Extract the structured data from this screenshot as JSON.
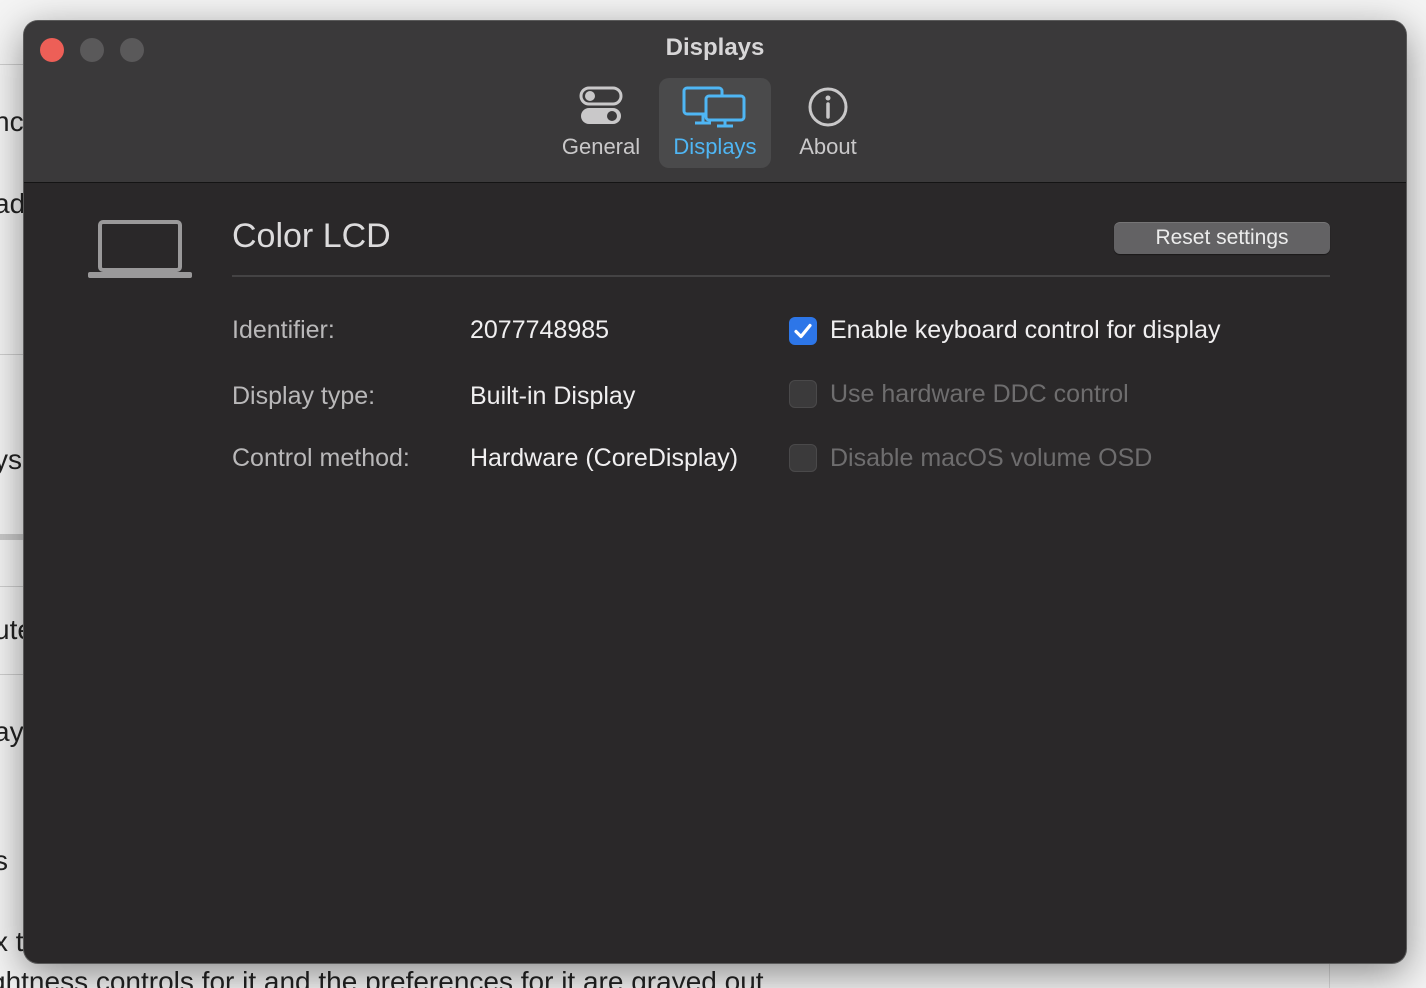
{
  "window": {
    "title": "Displays"
  },
  "tabs": [
    {
      "label": "General",
      "icon": "toggle-switches-icon",
      "selected": false
    },
    {
      "label": "Displays",
      "icon": "displays-icon",
      "selected": true
    },
    {
      "label": "About",
      "icon": "info-circle-icon",
      "selected": false
    }
  ],
  "display": {
    "icon": "laptop-icon",
    "name": "Color LCD",
    "reset_label": "Reset settings",
    "fields": [
      {
        "label": "Identifier:",
        "value": "2077748985"
      },
      {
        "label": "Display type:",
        "value": "Built-in Display"
      },
      {
        "label": "Control method:",
        "value": "Hardware (CoreDisplay)"
      }
    ],
    "options": [
      {
        "label": "Enable keyboard control for display",
        "checked": true,
        "enabled": true
      },
      {
        "label": "Use hardware DDC control",
        "checked": false,
        "enabled": false
      },
      {
        "label": "Disable macOS volume OSD",
        "checked": false,
        "enabled": false
      }
    ]
  },
  "background": {
    "fragments": [
      "nc",
      "ad",
      "ys",
      "ute",
      "ay",
      "s",
      "x t"
    ],
    "bottom_text": "ghtness controls for it and the preferences for it are grayed out"
  },
  "colors": {
    "accent": "#4fb6f4",
    "checkbox_on": "#2d76e8",
    "close_button": "#ed5f57",
    "window_bg": "#2a2829",
    "toolbar_bg": "#3a393a"
  }
}
